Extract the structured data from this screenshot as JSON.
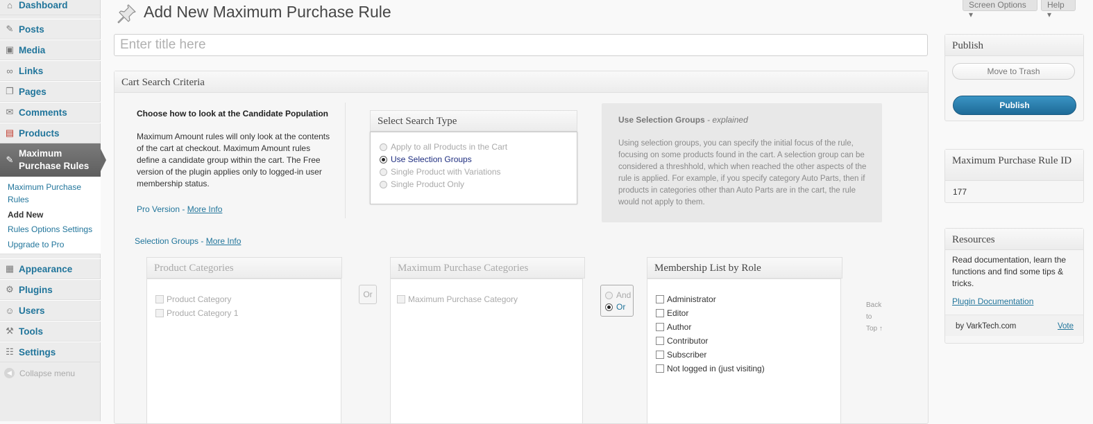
{
  "sidebar": {
    "items": [
      {
        "label": "Dashboard",
        "icon": "dashboard-icon",
        "glyph": "⌂"
      },
      {
        "label": "Posts",
        "icon": "pin-icon",
        "glyph": "✎"
      },
      {
        "label": "Media",
        "icon": "media-icon",
        "glyph": "▣"
      },
      {
        "label": "Links",
        "icon": "link-icon",
        "glyph": "∞"
      },
      {
        "label": "Pages",
        "icon": "pages-icon",
        "glyph": "❐"
      },
      {
        "label": "Comments",
        "icon": "comment-icon",
        "glyph": "✉"
      },
      {
        "label": "Products",
        "icon": "products-icon",
        "glyph": "▤"
      },
      {
        "label": "Maximum Purchase Rules",
        "icon": "pin-icon",
        "glyph": "✎"
      }
    ],
    "submenu": [
      "Maximum Purchase Rules",
      "Add New",
      "Rules Options Settings",
      "Upgrade to Pro"
    ],
    "lower_items": [
      {
        "label": "Appearance",
        "icon": "appearance-icon",
        "glyph": "▦"
      },
      {
        "label": "Plugins",
        "icon": "plugin-icon",
        "glyph": "⚙"
      },
      {
        "label": "Users",
        "icon": "users-icon",
        "glyph": "☺"
      },
      {
        "label": "Tools",
        "icon": "tools-icon",
        "glyph": "⚒"
      },
      {
        "label": "Settings",
        "icon": "settings-icon",
        "glyph": "☷"
      }
    ],
    "collapse_label": "Collapse menu"
  },
  "topbar": {
    "screen_options": "Screen Options ▾",
    "help": "Help ▾"
  },
  "page": {
    "title": "Add New Maximum Purchase Rule",
    "title_placeholder": "Enter title here"
  },
  "cart_search": {
    "box_title": "Cart Search Criteria",
    "intro_title": "Choose how to look at the Candidate Population",
    "intro_text": "Maximum Amount rules will only look at the contents of the cart at checkout. Maximum Amount rules define a candidate group within the cart. The Free version of the plugin applies only to logged-in user membership status.",
    "pro_prefix": "Pro Version - ",
    "pro_link": "More Info",
    "selection_prefix": "Selection Groups - ",
    "selection_link": "More Info",
    "search_type_title": "Select Search Type",
    "search_types": [
      {
        "label": "Apply to all Products in the Cart",
        "selected": false
      },
      {
        "label": "Use Selection Groups",
        "selected": true
      },
      {
        "label": "Single Product with Variations",
        "selected": false
      },
      {
        "label": "Single Product Only",
        "selected": false
      }
    ],
    "explain_title": "Use Selection Groups",
    "explain_suffix": " - explained",
    "explain_text": "Using selection groups, you can specify the initial focus of the rule, focusing on some products found in the cart. A selection group can be considered a threshhold, which when reached the other aspects of the rule is applied. For example, if you specify category Auto Parts, then if products in categories other than Auto Parts are in the cart, the rule would not apply to them."
  },
  "groups": {
    "product_categories_title": "Product Categories",
    "product_categories": [
      "Product Category",
      "Product Category 1"
    ],
    "or_label": "Or",
    "max_categories_title": "Maximum Purchase Categories",
    "max_categories": [
      "Maximum Purchase Category"
    ],
    "and_label": "And",
    "or2_label": "Or",
    "membership_title": "Membership List by Role",
    "roles": [
      "Administrator",
      "Editor",
      "Author",
      "Contributor",
      "Subscriber",
      "Not logged in (just visiting)"
    ],
    "back_to_top": [
      "Back",
      "to",
      "Top ↑"
    ]
  },
  "publish": {
    "title": "Publish",
    "trash_label": "Move to Trash",
    "publish_label": "Publish"
  },
  "rule_id": {
    "title": "Maximum Purchase Rule ID",
    "value": "177"
  },
  "resources": {
    "title": "Resources",
    "text": "Read documentation, learn the functions and find some tips & tricks.",
    "doc_link": "Plugin Documentation",
    "by": "by VarkTech.com",
    "vote": "Vote"
  }
}
